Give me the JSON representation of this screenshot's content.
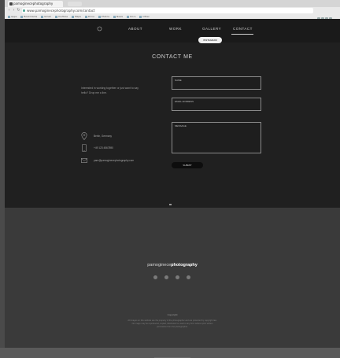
{
  "browser": {
    "tab_title": "pamoginecephotography",
    "url": "www.pamoginecephotography.com/contact",
    "bookmarks": [
      "Apps",
      "Bookmarks",
      "Gmail",
      "YouTube",
      "Maps",
      "Drive",
      "Photos",
      "News",
      "Docs",
      "Other"
    ]
  },
  "nav": {
    "about": "ABOUT",
    "work": "WORK",
    "gallery": "GALLERY",
    "contact": "CONTACT",
    "pill": "INSTAGRAM"
  },
  "contact": {
    "title": "CONTACT ME",
    "intro": "Interested in working together or just want to say hello? Drop me a line.",
    "name_placeholder": "NAME",
    "email_placeholder": "EMAIL ADDRESS",
    "message_placeholder": "MESSAGE",
    "send_label": "SUBMIT",
    "location": "Berlin, Germany",
    "phone": "+49 123 4567890",
    "email": "pam@pamoginecephotography.com"
  },
  "footer": {
    "brand_light": "pamoginece",
    "brand_bold": "photography",
    "copyright_title": "Copyright",
    "copyright_text": "All images on this website are the property of the photographer and are protected by copyright law. No image may be reproduced, copied, distributed or used in any form without prior written permission from the photographer."
  },
  "colors": {
    "page_bg": "#202020",
    "footer_bg": "#3a3a3a",
    "accent_text": "#d0d0d0"
  },
  "icons": [
    "home-icon",
    "location-icon",
    "phone-icon",
    "mail-icon",
    "facebook-icon",
    "instagram-icon",
    "linkedin-icon",
    "twitter-icon"
  ]
}
